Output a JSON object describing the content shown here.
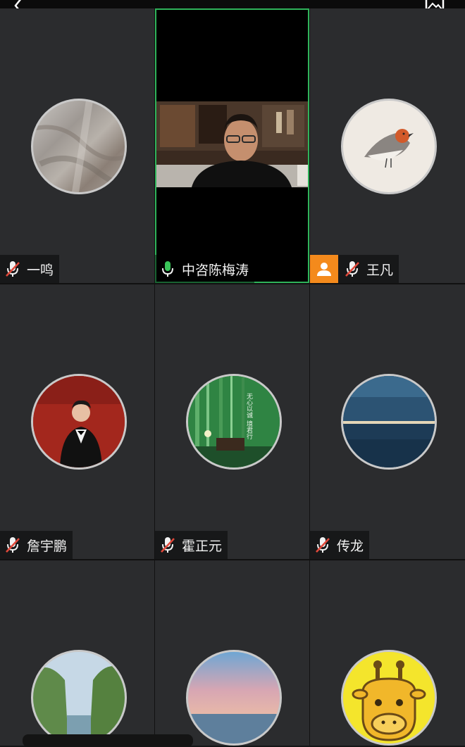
{
  "top_bar": {
    "back_icon": "chevron-left-icon",
    "gallery_icon": "image-icon"
  },
  "participants": [
    {
      "name": "一鸣",
      "mic": "muted",
      "avatar": "marble-texture"
    },
    {
      "name": "中咨陈梅涛",
      "mic": "active",
      "video": "on",
      "speaking": true
    },
    {
      "name": "王凡",
      "mic": "muted",
      "avatar": "robin-bird",
      "host": true
    },
    {
      "name": "詹宇鹏",
      "mic": "muted",
      "avatar": "man-in-tuxedo"
    },
    {
      "name": "霍正元",
      "mic": "muted",
      "avatar": "bamboo-forest",
      "avatar_text": "无心以诚 境君行"
    },
    {
      "name": "传龙",
      "mic": "muted",
      "avatar": "ocean-sunset"
    },
    {
      "name": "",
      "mic": "muted",
      "avatar": "tree-lined-canal"
    },
    {
      "name": "",
      "mic": "muted",
      "avatar": "sea-sky-dusk"
    },
    {
      "name": "",
      "mic": "muted",
      "avatar": "cartoon-giraffe"
    }
  ],
  "colors": {
    "speaker_border": "#2fb35a",
    "host_badge": "#f48a1c",
    "mic_muted": "#e0483a",
    "mic_active": "#39c559",
    "tile_bg": "#2b2c2e"
  }
}
